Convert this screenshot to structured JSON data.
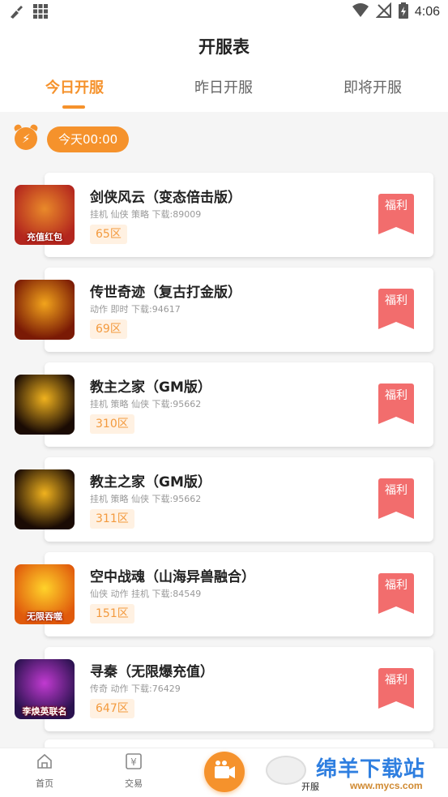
{
  "status_bar": {
    "time": "4:06",
    "icons": [
      "cleaner-icon",
      "grid-icon",
      "wifi-icon",
      "signal-off-icon",
      "battery-icon"
    ]
  },
  "header": {
    "title": "开服表",
    "tabs": [
      {
        "label": "今日开服",
        "active": true
      },
      {
        "label": "昨日开服",
        "active": false
      },
      {
        "label": "即将开服",
        "active": false
      }
    ]
  },
  "time_filter": {
    "icon": "alarm-clock-icon",
    "label": "今天00:00"
  },
  "games": [
    {
      "name": "剑侠风云（变态倍击版）",
      "meta": "挂机 仙侠 策略 下载:89009",
      "zone": "65区",
      "badge": "福利",
      "thumb_caption": "充值红包",
      "thumb_colors": [
        "#b3261e",
        "#e98a2a"
      ]
    },
    {
      "name": "传世奇迹（复古打金版）",
      "meta": "动作 即时 下载:94617",
      "zone": "69区",
      "badge": "福利",
      "thumb_caption": "",
      "thumb_colors": [
        "#7a1a05",
        "#f2a41c"
      ]
    },
    {
      "name": "教主之家（GM版）",
      "meta": "挂机 策略 仙侠 下载:95662",
      "zone": "310区",
      "badge": "福利",
      "thumb_caption": "",
      "thumb_colors": [
        "#1a0b04",
        "#f0b21e"
      ]
    },
    {
      "name": "教主之家（GM版）",
      "meta": "挂机 策略 仙侠 下载:95662",
      "zone": "311区",
      "badge": "福利",
      "thumb_caption": "",
      "thumb_colors": [
        "#1a0b04",
        "#f0b21e"
      ]
    },
    {
      "name": "空中战魂（山海异兽融合）",
      "meta": "仙侠 动作 挂机 下载:84549",
      "zone": "151区",
      "badge": "福利",
      "thumb_caption": "无限吞噬",
      "thumb_colors": [
        "#e05a0c",
        "#ffd32a"
      ]
    },
    {
      "name": "寻秦（无限爆充值）",
      "meta": "传奇 动作 下载:76429",
      "zone": "647区",
      "badge": "福利",
      "thumb_caption": "李焕英联名",
      "thumb_colors": [
        "#2a124f",
        "#c13ad1"
      ]
    }
  ],
  "bottom_nav": {
    "items": [
      {
        "label": "首页",
        "icon": "home-icon"
      },
      {
        "label": "交易",
        "icon": "trade-icon"
      },
      {
        "label": "",
        "icon": "video-camera-icon"
      },
      {
        "label": "开服",
        "icon": "server-icon"
      }
    ]
  },
  "watermark": {
    "text": "绵羊下载站",
    "url": "www.mycs.com"
  },
  "colors": {
    "accent": "#f5922c",
    "badge": "#f26d6d",
    "zone_bg": "#fff1e2",
    "zone_text": "#f39a3e"
  }
}
